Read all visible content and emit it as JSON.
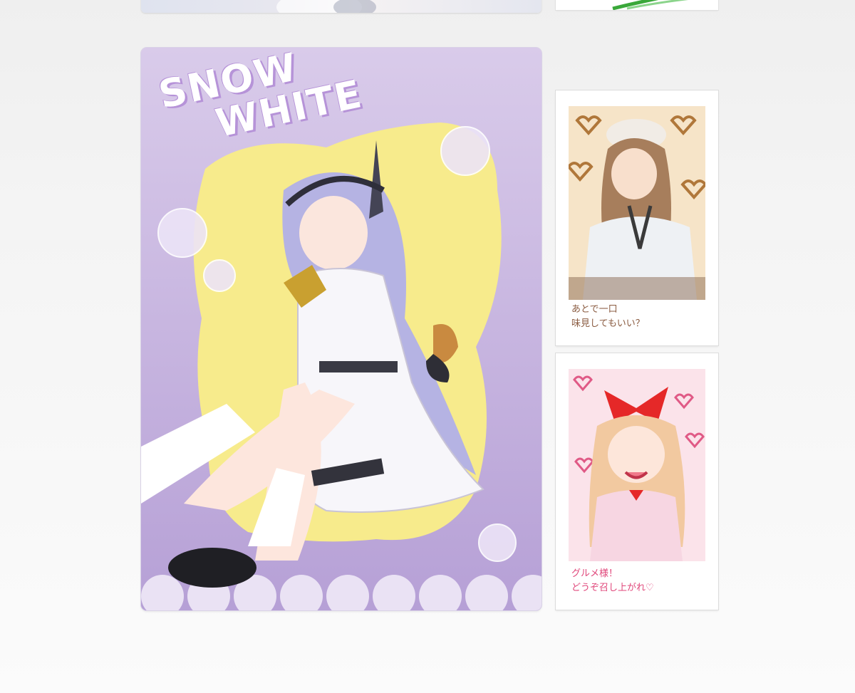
{
  "main_card": {
    "title_line1": "SNOW",
    "title_line2": "WHITE"
  },
  "photo_cards": [
    {
      "caption": "あとで一口\n味見してもいい？"
    },
    {
      "caption": "グルメ様！\nどうぞ召し上がれ♡"
    }
  ],
  "colors": {
    "card_purple": "#c8b6e2",
    "blob_yellow": "#f7eb8c",
    "caption_brown": "#8a5b40",
    "caption_pink": "#e0467a"
  }
}
